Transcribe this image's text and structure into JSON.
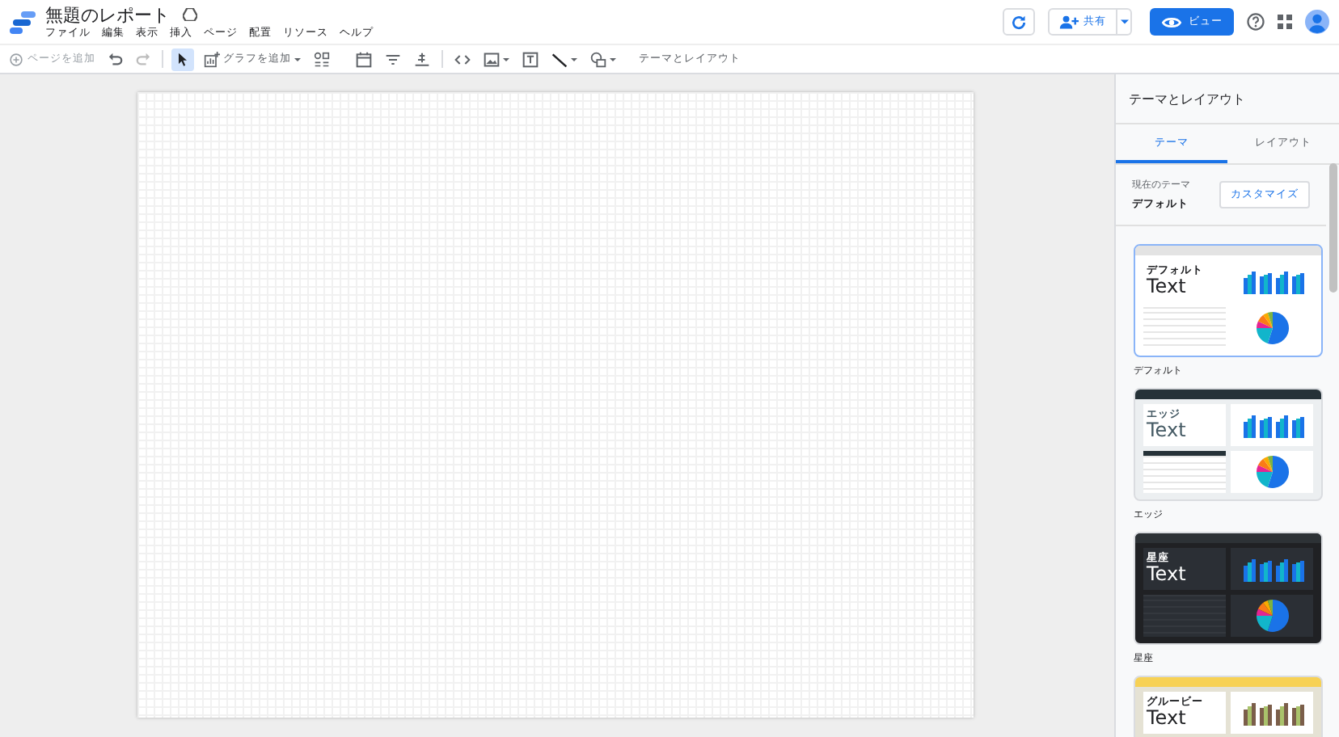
{
  "header": {
    "title": "無題のレポート",
    "menu": [
      "ファイル",
      "編集",
      "表示",
      "挿入",
      "ページ",
      "配置",
      "リソース",
      "ヘルプ"
    ],
    "share": "共有",
    "view": "ビュー"
  },
  "toolbar": {
    "add_page": {
      "label": "ページを追加",
      "disabled": true
    },
    "tools": [
      {
        "kind": "select",
        "selected": true
      },
      {
        "kind": "chart",
        "label": "グラフを追加",
        "selected": false
      },
      {
        "kind": "community",
        "selected": false
      },
      {
        "kind": "date",
        "selected": false
      },
      {
        "kind": "filter",
        "selected": false
      },
      {
        "kind": "control",
        "selected": false
      },
      {
        "kind": "code",
        "selected": false
      },
      {
        "kind": "image",
        "selected": false
      },
      {
        "kind": "textbox",
        "selected": false
      },
      {
        "kind": "line",
        "selected": false
      },
      {
        "kind": "shape",
        "selected": false
      }
    ],
    "theme_layout": "テーマとレイアウト"
  },
  "panel": {
    "title": "テーマとレイアウト",
    "tabs": [
      {
        "label": "テーマ",
        "selected": true
      },
      {
        "label": "レイアウト",
        "selected": false
      }
    ],
    "current_label": "現在のテーマ",
    "current_value": "デフォルト",
    "customize": "カスタマイズ",
    "themes": [
      {
        "kind": "default",
        "preview_label": "デフォルト",
        "preview_text": "Text",
        "name": "デフォルト",
        "selected": true
      },
      {
        "kind": "edge",
        "preview_label": "エッジ",
        "preview_text": "Text",
        "name": "エッジ",
        "selected": false
      },
      {
        "kind": "constellation",
        "preview_label": "星座",
        "preview_text": "Text",
        "name": "星座",
        "selected": false
      },
      {
        "kind": "groovy",
        "preview_label": "グルービー",
        "preview_text": "Text",
        "selected": false
      }
    ]
  }
}
